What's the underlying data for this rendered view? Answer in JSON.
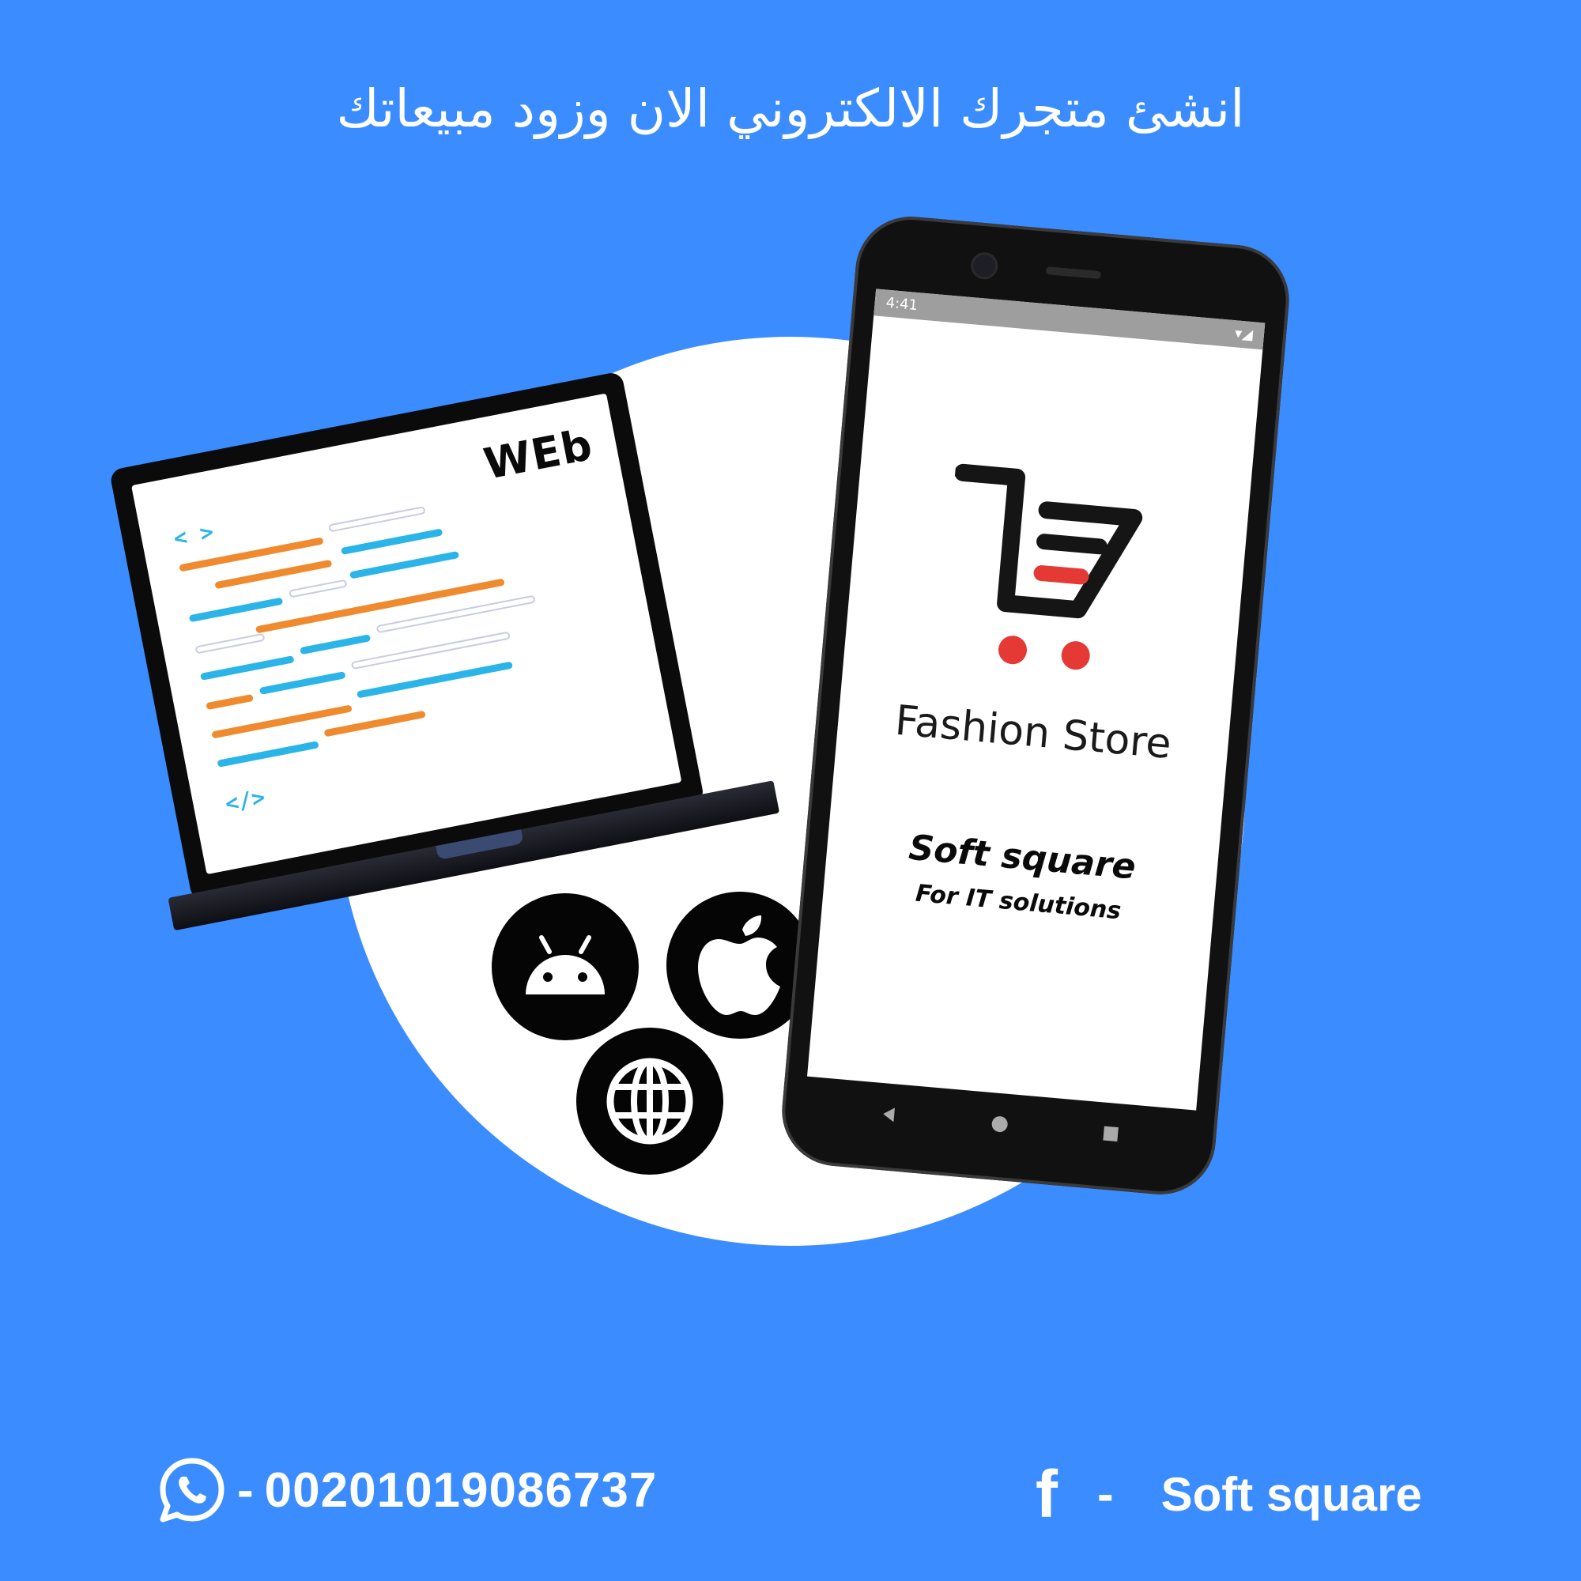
{
  "headline": "انشئ متجرك الالكتروني الان وزود مبيعاتك",
  "laptop": {
    "screen_label": "WEb",
    "open_tag": "< >",
    "close_tag": "</>"
  },
  "platforms": {
    "icons": [
      "android-icon",
      "apple-icon",
      "globe-icon"
    ]
  },
  "phone": {
    "status_time": "4:41",
    "store_name": "Fashion Store",
    "brand": "Soft square",
    "tagline": "For IT solutions"
  },
  "footer": {
    "whatsapp_separator": "-",
    "whatsapp_number": "00201019086737",
    "facebook_letter": "f",
    "facebook_separator": "-",
    "facebook_page": "Soft square"
  },
  "colors": {
    "background": "#3b8cff",
    "cart_red": "#e53935",
    "code_orange": "#ef8a2f",
    "code_blue": "#2bb4e8"
  }
}
